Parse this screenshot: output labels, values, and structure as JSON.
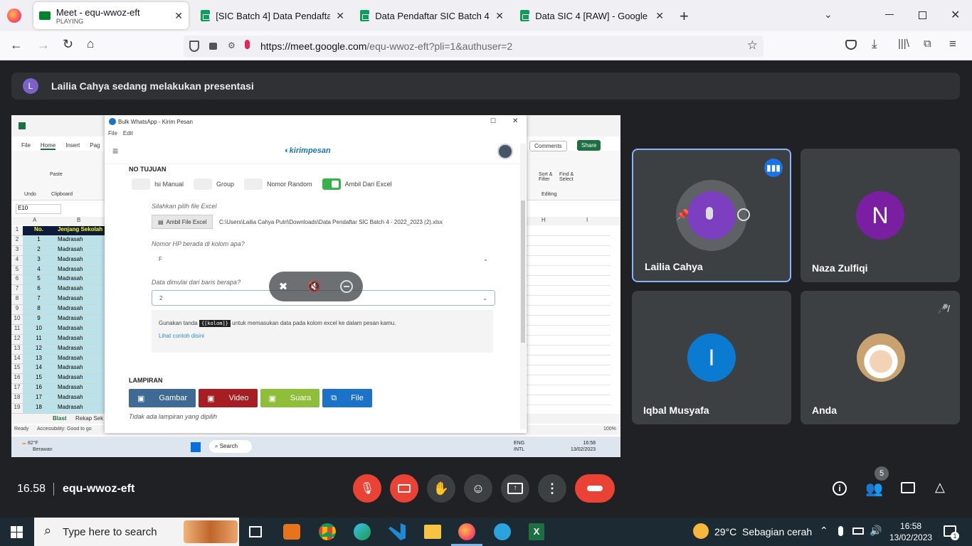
{
  "browser": {
    "tabs": [
      {
        "title": "Meet - equ-wwoz-eft",
        "subtitle": "PLAYING"
      },
      {
        "title": "[SIC Batch 4] Data Pendaftar Ma"
      },
      {
        "title": "Data Pendaftar SIC Batch 4 - 202"
      },
      {
        "title": "Data SIC 4 [RAW] - Google Spre"
      }
    ],
    "url_domain": "https://meet.google.com",
    "url_path": "/equ-wwoz-eft?pli=1&authuser=2"
  },
  "meet": {
    "banner_initial": "L",
    "banner_text": "Lailia Cahya sedang melakukan presentasi",
    "time": "16.58",
    "meeting_code": "equ-wwoz-eft",
    "people_count": "5",
    "participants": [
      {
        "name": "Lailia Cahya",
        "initial": "",
        "avatar_color": "#7b3fbf"
      },
      {
        "name": "Naza Zulfiqi",
        "initial": "N",
        "avatar_color": "#7b1fa2"
      },
      {
        "name": "Iqbal Musyafa",
        "initial": "I",
        "avatar_color": "#0b7bd1"
      },
      {
        "name": "Anda",
        "initial": "",
        "avatar_color": "#f3dcc5"
      }
    ]
  },
  "shared": {
    "window_title": "Bulk WhatsApp - Kirim Pesan",
    "menu": [
      "File",
      "Edit"
    ],
    "logo": "kirimpesan",
    "section_no_tujuan": "NO TUJUAN",
    "options": [
      "Isi Manual",
      "Group",
      "Nomor Random",
      "Ambil Dari Excel"
    ],
    "label_pilih": "Silahkan pilih file Excel",
    "btn_ambil": "Ambil File Excel",
    "file_path": "C:\\Users\\Lailia Cahya Putri\\Downloads\\Data Pendaftar SIC Batch 4 - 2022_2023 (2).xlsx",
    "label_kolom": "Nomor HP berada di kolom apa?",
    "kolom_value": "F",
    "label_baris": "Data dimulai dari baris berapa?",
    "baris_value": "2",
    "hint_a": "Gunakan tanda",
    "hint_code": "{[kolom]}",
    "hint_b": "untuk memasukan data pada kolom excel ke dalam pesan kamu.",
    "hint_link": "Lihat contoh disini",
    "section_lampiran": "LAMPIRAN",
    "attach_buttons": [
      {
        "label": "Gambar",
        "color": "#3f6a93"
      },
      {
        "label": "Video",
        "color": "#a61e22"
      },
      {
        "label": "Suara",
        "color": "#8fbf3a"
      },
      {
        "label": "File",
        "color": "#1a73c8"
      }
    ],
    "no_attachment": "Tidak ada lampiran yang dipilih",
    "excel": {
      "ribbon_tabs": [
        "File",
        "Home",
        "Insert",
        "Pag"
      ],
      "namebox": "E10",
      "col_a": "A",
      "col_b": "B",
      "header_no": "No.",
      "header_jenjang": "Jenjang Sekolah",
      "rows": [
        [
          "2",
          "1",
          "Madrasah"
        ],
        [
          "3",
          "2",
          "Madrasah"
        ],
        [
          "4",
          "3",
          "Madrasah"
        ],
        [
          "5",
          "4",
          "Madrasah"
        ],
        [
          "6",
          "5",
          "Madrasah"
        ],
        [
          "7",
          "6",
          "Madrasah"
        ],
        [
          "8",
          "7",
          "Madrasah"
        ],
        [
          "9",
          "8",
          "Madrasah"
        ],
        [
          "10",
          "9",
          "Madrasah"
        ],
        [
          "11",
          "10",
          "Madrasah"
        ],
        [
          "12",
          "11",
          "Madrasah"
        ],
        [
          "13",
          "12",
          "Madrasah"
        ],
        [
          "14",
          "13",
          "Madrasah"
        ],
        [
          "15",
          "14",
          "Madrasah"
        ],
        [
          "16",
          "15",
          "Madrasah"
        ],
        [
          "17",
          "16",
          "Madrasah"
        ],
        [
          "18",
          "17",
          "Madrasah"
        ],
        [
          "19",
          "18",
          "Madrasah"
        ]
      ],
      "sheet_tabs": [
        "Blast",
        "Rekap Sek"
      ],
      "status": "Ready",
      "accessibility": "Accessibility: Good to go",
      "comments": "Comments",
      "share": "Share",
      "sort_filter": "Sort & Filter",
      "find_select": "Find & Select",
      "editing": "Editing",
      "col_h": "H",
      "col_i": "I",
      "zoom": "100%"
    },
    "inner_taskbar": {
      "weather_temp": "82°F",
      "weather_desc": "Berawan",
      "search": "Search",
      "lang": "ENG",
      "lang2": "INTL",
      "time": "16:58",
      "date": "13/02/2023"
    }
  },
  "taskbar": {
    "search_placeholder": "Type here to search",
    "weather": "29°C  Sebagian cerah",
    "time": "16:58",
    "date": "13/02/2023",
    "notif_count": "1"
  }
}
